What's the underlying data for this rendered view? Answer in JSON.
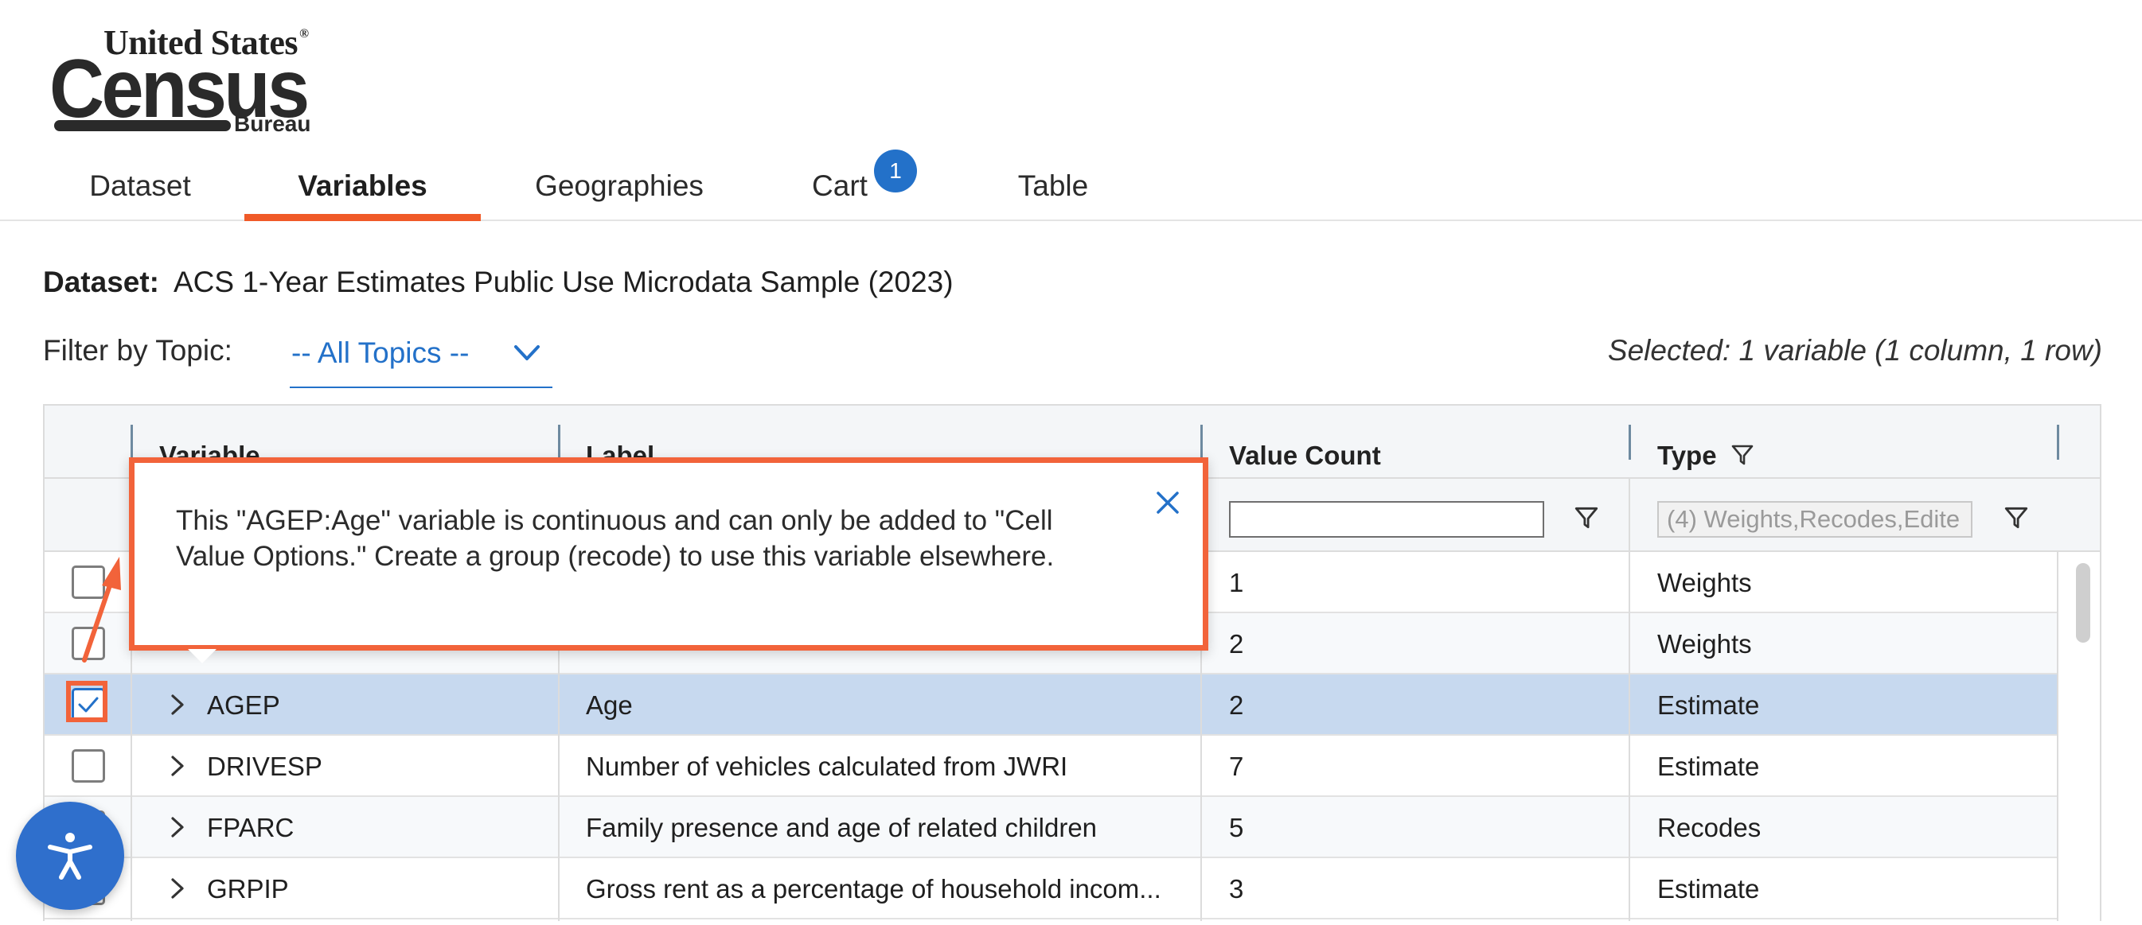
{
  "logo": {
    "line1": "United States",
    "registered": "®",
    "line2": "Census",
    "line3": "Bureau"
  },
  "tabs": [
    {
      "label": "Dataset",
      "active": false
    },
    {
      "label": "Variables",
      "active": true
    },
    {
      "label": "Geographies",
      "active": false
    },
    {
      "label": "Cart",
      "active": false,
      "badge": "1"
    },
    {
      "label": "Table",
      "active": false
    }
  ],
  "dataset": {
    "label": "Dataset:",
    "value": "ACS 1-Year Estimates Public Use Microdata Sample (2023)"
  },
  "filter": {
    "label": "Filter by Topic:",
    "value": "-- All Topics --"
  },
  "selected_info": "Selected: 1 variable (1 column, 1 row)",
  "table": {
    "columns": [
      "Variable",
      "Label",
      "Value Count",
      "Type"
    ],
    "type_filter_value": "(4) Weights,Recodes,Edite",
    "value_count_filter_value": "",
    "rows": [
      {
        "variable": "",
        "label": "",
        "value_count": "1",
        "type": "Weights",
        "checked": false,
        "selected": false
      },
      {
        "variable": "",
        "label": "",
        "value_count": "2",
        "type": "Weights",
        "checked": false,
        "selected": false
      },
      {
        "variable": "AGEP",
        "label": "Age",
        "value_count": "2",
        "type": "Estimate",
        "checked": true,
        "selected": true
      },
      {
        "variable": "DRIVESP",
        "label": "Number of vehicles calculated from JWRI",
        "value_count": "7",
        "type": "Estimate",
        "checked": false,
        "selected": false
      },
      {
        "variable": "FPARC",
        "label": "Family presence and age of related children",
        "value_count": "5",
        "type": "Recodes",
        "checked": false,
        "selected": false
      },
      {
        "variable": "GRPIP",
        "label": "Gross rent as a percentage of household incom...",
        "value_count": "3",
        "type": "Estimate",
        "checked": false,
        "selected": false
      }
    ]
  },
  "popup": {
    "message": "This \"AGEP:Age\" variable is continuous and can only be added to \"Cell Value Options.\" Create a group (recode) to use this variable elsewhere."
  },
  "colors": {
    "accent": "#f05a28",
    "highlight": "#f2633a",
    "link_blue": "#2371c9",
    "selected_row": "#c7d9ef",
    "a11y_button": "#2f6fcc"
  },
  "icons": {
    "filter": "funnel-icon",
    "close": "close-icon",
    "expand": "chevron-right-icon",
    "dropdown": "chevron-down-icon",
    "accessibility": "accessibility-icon"
  }
}
